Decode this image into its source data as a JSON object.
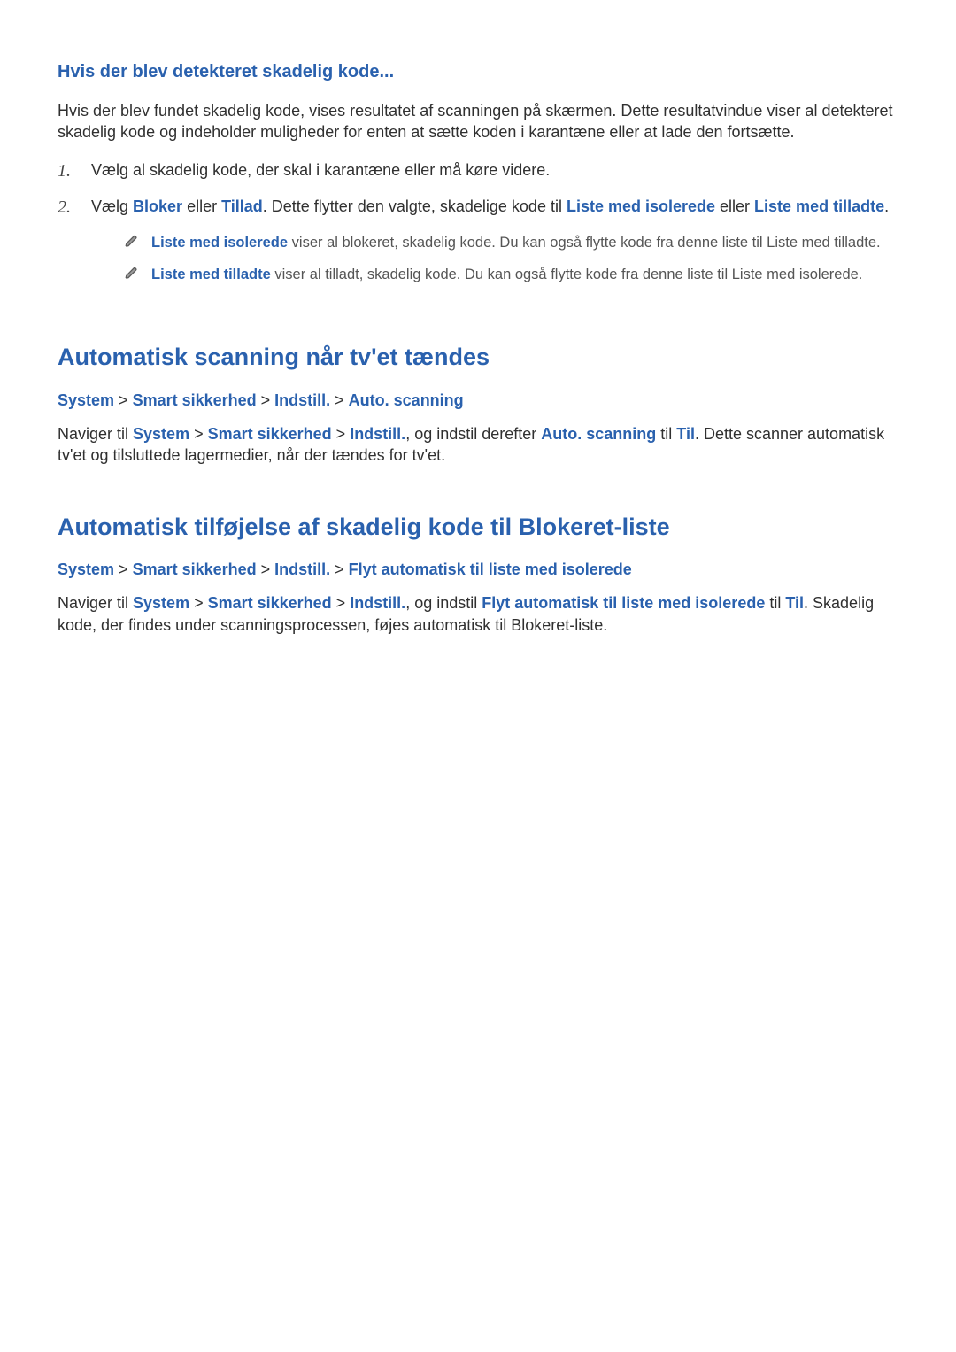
{
  "section1": {
    "heading": "Hvis der blev detekteret skadelig kode...",
    "intro": "Hvis der blev fundet skadelig kode, vises resultatet af scanningen på skærmen. Dette resultatvindue viser al detekteret skadelig kode og indeholder muligheder for enten at sætte koden i karantæne eller at lade den fortsætte.",
    "step1": "Vælg al skadelig kode, der skal i karantæne eller må køre videre.",
    "step2": {
      "t1": "Vælg ",
      "bloker": "Bloker",
      "t2": " eller ",
      "tillad": "Tillad",
      "t3": ". Dette flytter den valgte, skadelige kode til ",
      "listeIsolerede": "Liste med isolerede",
      "t4": " eller ",
      "listeTilladte": "Liste med tilladte",
      "t5": "."
    },
    "note1": {
      "lead": "Liste med isolerede",
      "rest": " viser al blokeret, skadelig kode. Du kan også flytte kode fra denne liste til Liste med tilladte."
    },
    "note2": {
      "lead": "Liste med tilladte",
      "rest": " viser al tilladt, skadelig kode. Du kan også flytte kode fra denne liste til Liste med isolerede."
    }
  },
  "section2": {
    "heading": "Automatisk scanning når tv'et tændes",
    "breadcrumb": {
      "b1": "System",
      "s": " > ",
      "b2": "Smart sikkerhed",
      "b3": "Indstill.",
      "b4": "Auto. scanning"
    },
    "body": {
      "t1": "Naviger til ",
      "system": "System",
      "sep1": " > ",
      "smart": "Smart sikkerhed",
      "sep2": " > ",
      "indstil": "Indstill.",
      "t2": ", og indstil derefter ",
      "auto": "Auto. scanning",
      "t3": " til ",
      "til": "Til",
      "t4": ". Dette scanner automatisk tv'et og tilsluttede lagermedier, når der tændes for tv'et."
    }
  },
  "section3": {
    "heading": "Automatisk tilføjelse af skadelig kode til Blokeret-liste",
    "breadcrumb": {
      "b1": "System",
      "s": " > ",
      "b2": "Smart sikkerhed",
      "b3": "Indstill.",
      "b4": "Flyt automatisk til liste med isolerede"
    },
    "body": {
      "t1": "Naviger til ",
      "system": "System",
      "sep1": " > ",
      "smart": "Smart sikkerhed",
      "sep2": " > ",
      "indstil": "Indstill.",
      "t2": ", og indstil ",
      "flyt": "Flyt automatisk til liste med isolerede",
      "t3": " til ",
      "til": "Til",
      "t4": ". Skadelig kode, der findes under scanningsprocessen, føjes automatisk til Blokeret-liste."
    }
  }
}
